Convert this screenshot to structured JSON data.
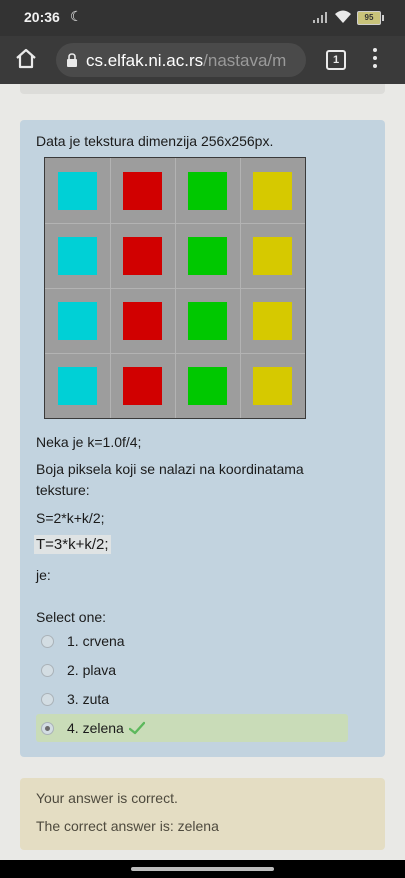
{
  "status_bar": {
    "time": "20:36",
    "battery": "95"
  },
  "browser": {
    "url_host": "cs.elfak.ni.ac.rs",
    "url_path": "/nastava/m",
    "tab_count": "1"
  },
  "question": {
    "intro": "Data je tekstura dimenzija 256x256px.",
    "texture": {
      "background": "#9d9d9d",
      "rows": [
        [
          "#00d0d6",
          "#d10000",
          "#00c800",
          "#d6c900"
        ],
        [
          "#00d0d6",
          "#d10000",
          "#00c800",
          "#d6c900"
        ],
        [
          "#00d0d6",
          "#d10000",
          "#00c800",
          "#d6c900"
        ],
        [
          "#00d0d6",
          "#d10000",
          "#00c800",
          "#d6c900"
        ]
      ]
    },
    "k_line": "Neka je k=1.0f/4;",
    "pixel_line_1": "Boja piksela koji se nalazi na koordinatama",
    "pixel_line_2": "teksture:",
    "s_formula": "S=2*k+k/2;",
    "t_formula": "T=3*k+k/2;",
    "je": "je:",
    "select_label": "Select one:",
    "options": [
      {
        "label": "1. crvena",
        "selected": false
      },
      {
        "label": "2. plava",
        "selected": false
      },
      {
        "label": "3. zuta",
        "selected": false
      },
      {
        "label": "4. zelena",
        "selected": true
      }
    ]
  },
  "feedback": {
    "result": "Your answer is correct.",
    "correct_answer": "The correct answer is: zelena"
  },
  "colors": {
    "question_bg": "#c2d3df",
    "feedback_bg": "#e4ddc3",
    "selected_bg": "#c9dcb8",
    "check": "#5cb85c"
  }
}
